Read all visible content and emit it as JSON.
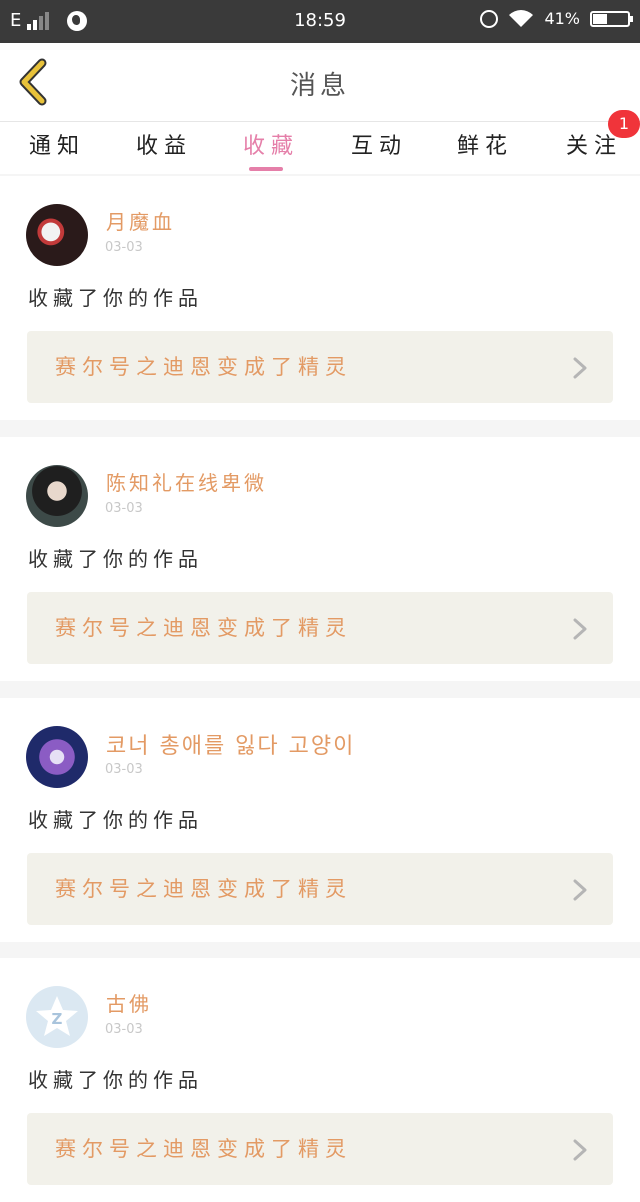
{
  "status_bar": {
    "network": "E",
    "time": "18:59",
    "battery": "41%",
    "battery_level": 0.41
  },
  "header": {
    "title": "消息",
    "back_icon": "chevron-left-icon",
    "accent": "#e8c23a"
  },
  "tabs": [
    {
      "label": "通知"
    },
    {
      "label": "收益"
    },
    {
      "label": "收藏",
      "active": true
    },
    {
      "label": "互动"
    },
    {
      "label": "鲜花"
    },
    {
      "label": "关注",
      "badge": "1"
    }
  ],
  "colors": {
    "accent": "#e57fa9",
    "username": "#e39a64",
    "badge": "#f0343a",
    "work_bg": "#f2f1ea"
  },
  "items": [
    {
      "username": "月魔血",
      "date": "03-03",
      "action": "收藏了你的作品",
      "work_title": "赛尔号之迪恩变成了精灵"
    },
    {
      "username": "陈知礼在线卑微",
      "date": "03-03",
      "action": "收藏了你的作品",
      "work_title": "赛尔号之迪恩变成了精灵"
    },
    {
      "username": "코너 총애를 잃다 고양이",
      "date": "03-03",
      "action": "收藏了你的作品",
      "work_title": "赛尔号之迪恩变成了精灵"
    },
    {
      "username": "古佛",
      "date": "03-03",
      "action": "收藏了你的作品",
      "work_title": "赛尔号之迪恩变成了精灵"
    }
  ]
}
